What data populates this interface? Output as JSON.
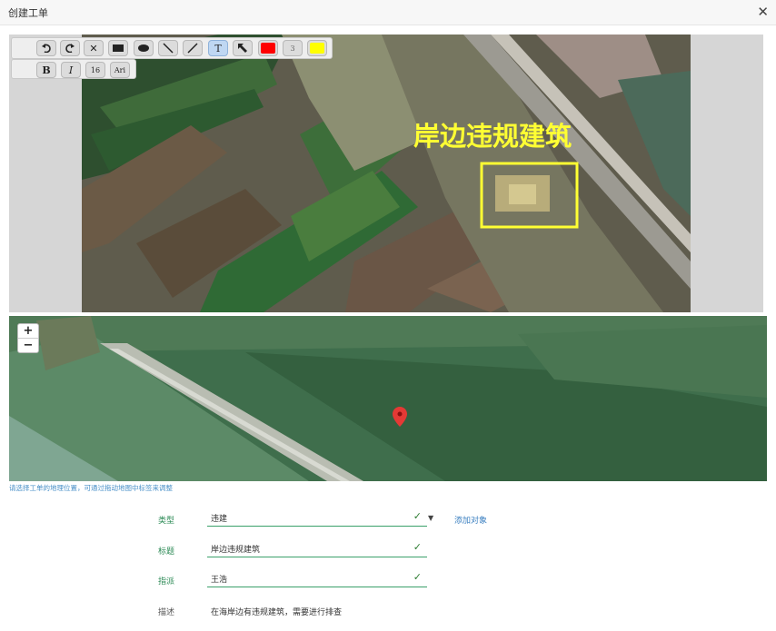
{
  "window": {
    "title": "创建工单"
  },
  "editor": {
    "annotation_text": "岸边违规建筑",
    "annotation_color": "#ffff33",
    "toolbar_row1": [
      {
        "name": "undo-icon"
      },
      {
        "name": "redo-icon"
      },
      {
        "name": "delete-icon"
      },
      {
        "name": "rectangle-icon"
      },
      {
        "name": "ellipse-icon"
      },
      {
        "name": "line-icon"
      },
      {
        "name": "pen-icon"
      },
      {
        "name": "text-icon"
      },
      {
        "name": "arrow-icon"
      },
      {
        "name": "red-color-swatch",
        "color": "#ff0000"
      },
      {
        "name": "stroke-width",
        "label": "3"
      },
      {
        "name": "yellow-color-swatch",
        "color": "#ffff00"
      }
    ],
    "toolbar_row2": [
      {
        "name": "bold-icon",
        "label": "B"
      },
      {
        "name": "italic-icon",
        "label": "I"
      },
      {
        "name": "font-size",
        "label": "16"
      },
      {
        "name": "font-family",
        "label": "Ari"
      }
    ]
  },
  "map": {
    "zoom_in": "+",
    "zoom_out": "−",
    "hint": "请选择工单的地理位置，可通过拖动地图中标签来调整",
    "pin_color": "#e53935"
  },
  "form": {
    "type_label": "类型",
    "type_value": "违建",
    "add_object": "添加对象",
    "title_label": "标题",
    "title_value": "岸边违规建筑",
    "assign_label": "指派",
    "assign_value": "王浩",
    "desc_label": "描述",
    "desc_value": "在海岸边有违规建筑，需要进行排查"
  }
}
